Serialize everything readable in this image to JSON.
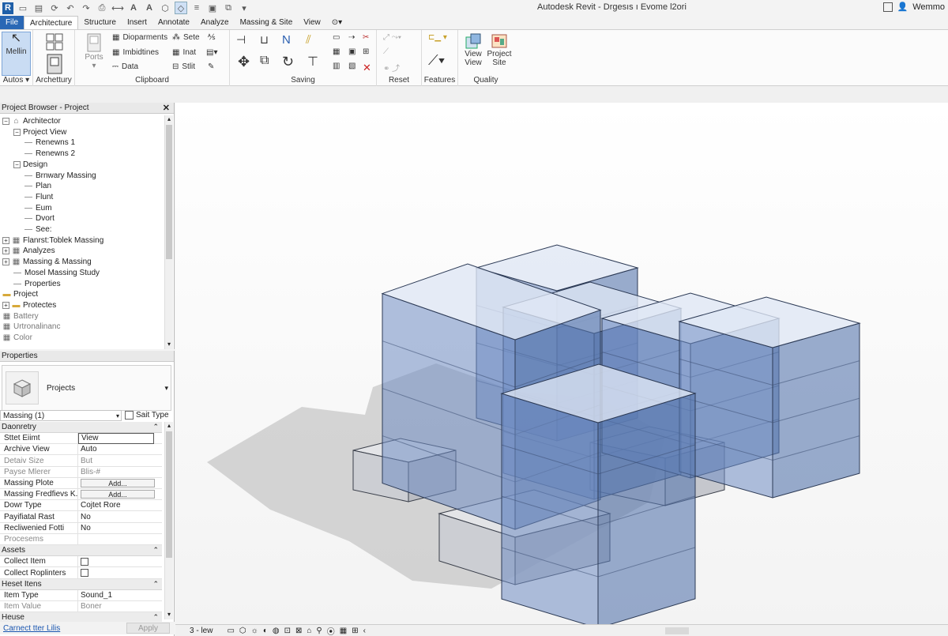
{
  "titlebar": {
    "app_title": "Autodesk Revit - Drgesıs ı Evome l2ori",
    "user": "Wemmo"
  },
  "tabs": [
    {
      "label": "File"
    },
    {
      "label": "Architecture"
    },
    {
      "label": "Structure"
    },
    {
      "label": "Insert"
    },
    {
      "label": "Annotate"
    },
    {
      "label": "Analyze"
    },
    {
      "label": "Massing & Site"
    },
    {
      "label": "View"
    }
  ],
  "ribbon": {
    "select": {
      "big_label": "Mellin",
      "group_label": "Autos"
    },
    "archetury": {
      "label": "Archettury"
    },
    "clipboard": {
      "ports_label": "Ports",
      "items": [
        "Dioparments",
        "Imbidtines",
        "Data"
      ],
      "items2": [
        "Sete",
        "Inat",
        "Stlit"
      ],
      "group_label": "Clipboard"
    },
    "saving": {
      "group_label": "Saving"
    },
    "reset": {
      "group_label": "Reset"
    },
    "features": {
      "group_label": "Features"
    },
    "quality": {
      "view_label": "View View",
      "project_label": "Project Site",
      "group_label": "Quality"
    }
  },
  "project_browser": {
    "title": "Project Browser - Project",
    "items": [
      {
        "label": "Architector",
        "level": 0,
        "expander": "−",
        "icon": "house-icon"
      },
      {
        "label": "Project View",
        "level": 1,
        "expander": "−"
      },
      {
        "label": "Renewns 1",
        "level": 2
      },
      {
        "label": "Renewns 2",
        "level": 2
      },
      {
        "label": "Design",
        "level": 1,
        "expander": "−"
      },
      {
        "label": "Brnwary Massing",
        "level": 2
      },
      {
        "label": "Plan",
        "level": 2
      },
      {
        "label": "Flunt",
        "level": 2
      },
      {
        "label": "Eum",
        "level": 2
      },
      {
        "label": "Dvort",
        "level": 2
      },
      {
        "label": "See:",
        "level": 2
      },
      {
        "label": "Flanrst:Toblek Massing",
        "level": 0,
        "expander": "+",
        "icon": "grid-icon"
      },
      {
        "label": "Analyzes",
        "level": 0,
        "expander": "+",
        "icon": "grid-icon"
      },
      {
        "label": "Massing & Massing",
        "level": 0,
        "expander": "+",
        "icon": "grid-icon"
      },
      {
        "label": "Mosel Massing Study",
        "level": 1
      },
      {
        "label": "Properties",
        "level": 1
      },
      {
        "label": "Project",
        "level": 0,
        "icon": "folder-icon"
      },
      {
        "label": "Protectes",
        "level": 0,
        "expander": "+",
        "icon": "folder-icon"
      },
      {
        "label": "Battery",
        "level": 0,
        "icon": "grid-icon",
        "muted": true
      },
      {
        "label": "Urtronalinanc",
        "level": 0,
        "icon": "grid-icon",
        "muted": true
      },
      {
        "label": "Color",
        "level": 0,
        "icon": "grid-icon",
        "muted": true
      }
    ]
  },
  "properties": {
    "title": "Properties",
    "type_name": "Projects",
    "selector": "Massing (1)",
    "edit_type": "Sait Type",
    "section1": "Daonretry",
    "rows1": [
      {
        "name": "Sttet Eiimt",
        "value": "View",
        "kind": "input"
      },
      {
        "name": "Archive View",
        "value": "Auto"
      },
      {
        "name": "Detaiv Size",
        "value": "But",
        "muted": true
      },
      {
        "name": "Payse Mlerer",
        "value": "Blis-#",
        "muted": true
      },
      {
        "name": "Massing Plote",
        "value": "Add...",
        "kind": "button"
      },
      {
        "name": "Massing Fredfievs K...",
        "value": "Add...",
        "kind": "button"
      },
      {
        "name": "Dowr Type",
        "value": "Cojtet Rore"
      },
      {
        "name": "Payifiatal Rast",
        "value": "No"
      },
      {
        "name": "Recliwenied Fotti",
        "value": "No"
      },
      {
        "name": "Procesems",
        "value": "",
        "muted": true
      }
    ],
    "section2": "Assets",
    "rows2": [
      {
        "name": "Collect Item",
        "kind": "checkbox"
      },
      {
        "name": "Collect Roplinters",
        "kind": "checkbox"
      }
    ],
    "section3": "Heset Itens",
    "rows3": [
      {
        "name": "Item Type",
        "value": "Sound_1"
      },
      {
        "name": "Item Value",
        "value": "Boner",
        "muted": true
      }
    ],
    "section4": "Heuse",
    "footer_link": "Carnect tter Lilis",
    "apply": "Apply"
  },
  "statusbar": {
    "scale": "3 - lew"
  }
}
